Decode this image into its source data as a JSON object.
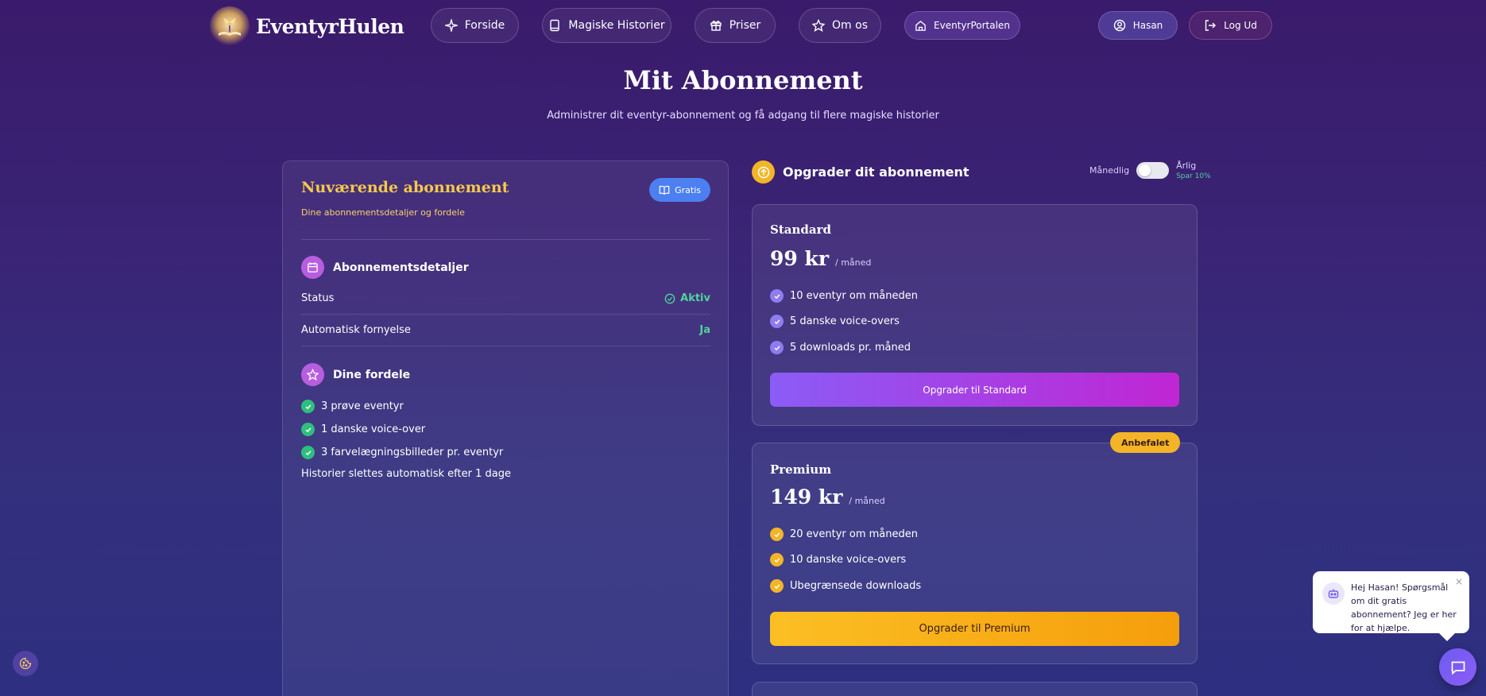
{
  "header": {
    "logo_text": "EventyrHulen",
    "nav": [
      {
        "label": "Forside",
        "icon": "sparkles-icon"
      },
      {
        "label": "Magiske Historier",
        "icon": "book-icon"
      },
      {
        "label": "Priser",
        "icon": "gift-icon"
      },
      {
        "label": "Om os",
        "icon": "star-icon"
      },
      {
        "label": "EventyrPortalen",
        "icon": "home-icon"
      }
    ],
    "user_label": "Hasan",
    "logout_label": "Log Ud"
  },
  "page": {
    "title": "Mit Abonnement",
    "subtitle": "Administrer dit eventyr-abonnement og få adgang til flere magiske historier"
  },
  "current_plan": {
    "title": "Nuværende abonnement",
    "subtitle": "Dine abonnementsdetaljer og fordele",
    "badge": "Gratis",
    "details_heading": "Abonnementsdetaljer",
    "status_label": "Status",
    "status_value": "Aktiv",
    "renewal_label": "Automatisk fornyelse",
    "renewal_value": "Ja",
    "benefits_heading": "Dine fordele",
    "benefits": [
      "3 prøve eventyr",
      "1 danske voice-over",
      "3 farvelægningsbilleder pr. eventyr"
    ],
    "note": "Historier slettes automatisk efter 1 dage"
  },
  "upgrade": {
    "heading": "Opgrader dit abonnement",
    "monthly_label": "Månedlig",
    "yearly_label": "Årlig",
    "yearly_save": "Spar 10%",
    "billing_yearly_selected": false,
    "recommended_label": "Anbefalet",
    "plans": [
      {
        "name": "Standard",
        "price": "99 kr",
        "period": "/ måned",
        "features": [
          "10 eventyr om måneden",
          "5 danske voice-overs",
          "5 downloads pr. måned"
        ],
        "button": "Opgrader til Standard"
      },
      {
        "name": "Premium",
        "price": "149 kr",
        "period": "/ måned",
        "features": [
          "20 eventyr om måneden",
          "10 danske voice-overs",
          "Ubegrænsede downloads"
        ],
        "button": "Opgrader til Premium"
      }
    ]
  },
  "chat": {
    "message": "Hej Hasan! Spørgsmål om dit gratis abonnement? Jeg er her for at hjælpe.",
    "close": "×"
  },
  "colors": {
    "accent_gold": "#f3b527",
    "accent_purple": "#8b5cf6",
    "success_green": "#4fd39a",
    "badge_blue": "#4c7ff0"
  }
}
